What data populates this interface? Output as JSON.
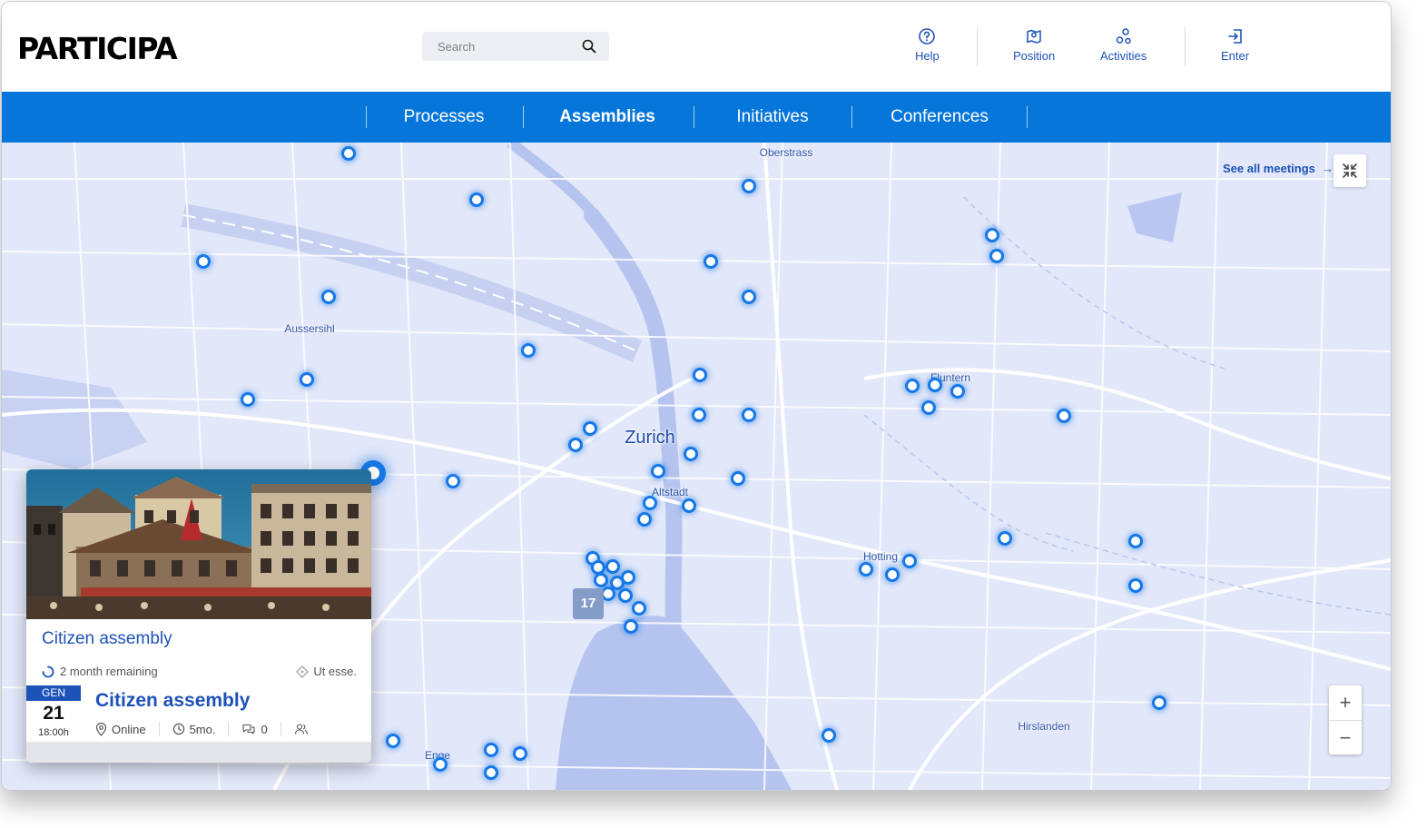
{
  "header": {
    "logo": "PARTICIPA",
    "search_placeholder": "Search",
    "help_label": "Help",
    "position_label": "Position",
    "activities_label": "Activities",
    "enter_label": "Enter"
  },
  "nav": {
    "items": [
      "Processes",
      "Assemblies",
      "Initiatives",
      "Conferences"
    ],
    "active": "Assemblies"
  },
  "map": {
    "labels": {
      "oberstrass": "Oberstrass",
      "aussersihl": "Aussersihl",
      "zurich": "Zurich",
      "altstadt": "Altstadt",
      "fluntern": "Fluntern",
      "hottingen": "Hotting",
      "hirslanden": "Hirslanden",
      "enge": "Enge"
    },
    "see_all": "See all meetings",
    "cluster_count": "17",
    "zoom_in": "+",
    "zoom_out": "−"
  },
  "card": {
    "assembly_title": "Citizen assembly",
    "remaining": "2 month remaining",
    "tag": "Ut esse.",
    "date_month": "GEN",
    "date_day": "21",
    "date_time": "18:00h",
    "meeting_title": "Citizen assembly",
    "location": "Online",
    "duration": "5mo.",
    "comments": "0"
  },
  "colors": {
    "accent": "#0676da",
    "link": "#1d52b8",
    "map_bg": "#e2e7f9",
    "pin": "#1677e6"
  }
}
